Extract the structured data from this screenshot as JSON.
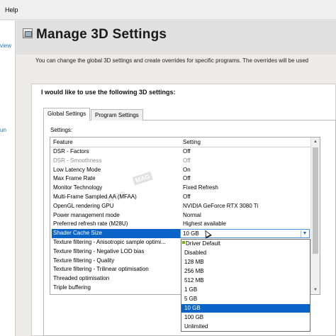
{
  "menubar": {
    "help": "Help"
  },
  "sidebar": {
    "fragments": [
      "view",
      "un"
    ]
  },
  "header": {
    "title": "Manage 3D Settings"
  },
  "intro_text": "You can change the global 3D settings and create overrides for specific programs. The overrides will be used",
  "panel": {
    "question": "I would like to use the following 3D settings:"
  },
  "tabs": [
    {
      "label": "Global Settings",
      "active": true
    },
    {
      "label": "Program Settings",
      "active": false
    }
  ],
  "settings_label": "Settings:",
  "grid": {
    "headers": [
      "Feature",
      "Setting"
    ],
    "rows": [
      {
        "feature": "DSR - Factors",
        "setting": "Off"
      },
      {
        "feature": "DSR - Smoothness",
        "setting": "Off",
        "disabled": true
      },
      {
        "feature": "Low Latency Mode",
        "setting": "On"
      },
      {
        "feature": "Max Frame Rate",
        "setting": "Off"
      },
      {
        "feature": "Monitor Technology",
        "setting": "Fixed Refresh"
      },
      {
        "feature": "Multi-Frame Sampled AA (MFAA)",
        "setting": "Off"
      },
      {
        "feature": "OpenGL rendering GPU",
        "setting": "NVIDIA GeForce RTX 3080 Ti"
      },
      {
        "feature": "Power management mode",
        "setting": "Normal"
      },
      {
        "feature": "Preferred refresh rate (M28U)",
        "setting": "Highest available"
      },
      {
        "feature": "Shader Cache Size",
        "setting": "10 GB",
        "selected": true
      },
      {
        "feature": "Texture filtering - Anisotropic sample optimi...",
        "setting": ""
      },
      {
        "feature": "Texture filtering - Negative LOD bias",
        "setting": ""
      },
      {
        "feature": "Texture filtering - Quality",
        "setting": ""
      },
      {
        "feature": "Texture filtering - Trilinear optimisation",
        "setting": ""
      },
      {
        "feature": "Threaded optimisation",
        "setting": ""
      },
      {
        "feature": "Triple buffering",
        "setting": ""
      }
    ]
  },
  "dropdown": {
    "options": [
      "Driver Default",
      "Disabled",
      "128 MB",
      "256 MB",
      "512 MB",
      "1 GB",
      "5 GB",
      "10 GB",
      "100 GB",
      "Unlimited"
    ],
    "selected": "10 GB",
    "default_marker_color": "#76b900"
  },
  "watermark": {
    "text_a": "WER",
    "text_b": "MAG"
  },
  "colors": {
    "selection": "#0a64c8",
    "link": "#1d6fc4"
  }
}
